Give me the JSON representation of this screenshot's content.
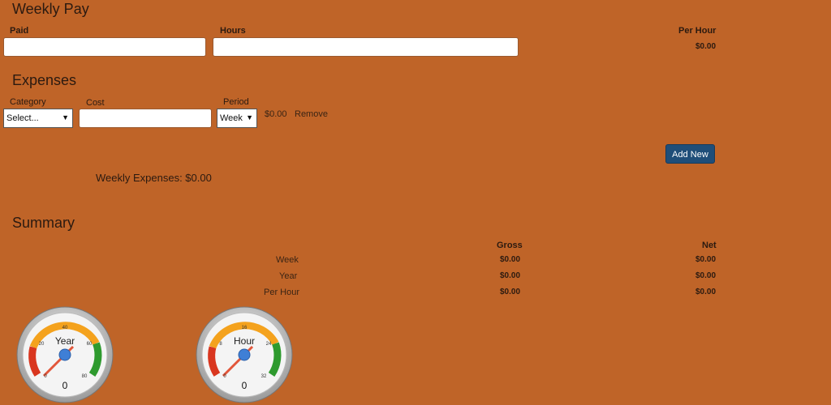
{
  "weekly_pay": {
    "title": "Weekly Pay",
    "paid_label": "Paid",
    "hours_label": "Hours",
    "per_hour_label": "Per Hour",
    "per_hour_value": "$0.00",
    "paid_value": "",
    "hours_value": ""
  },
  "expenses": {
    "title": "Expenses",
    "category_label": "Category",
    "category_value": "Select...",
    "cost_label": "Cost",
    "cost_value": "",
    "period_label": "Period",
    "period_value": "Week",
    "amount": "$0.00",
    "remove_label": "Remove",
    "add_new_label": "Add New",
    "weekly_expenses": "Weekly Expenses: $0.00"
  },
  "summary": {
    "title": "Summary",
    "gross_header": "Gross",
    "net_header": "Net",
    "rows": [
      {
        "label": "Week",
        "gross": "$0.00",
        "net": "$0.00"
      },
      {
        "label": "Year",
        "gross": "$0.00",
        "net": "$0.00"
      },
      {
        "label": "Per Hour",
        "gross": "$0.00",
        "net": "$0.00"
      }
    ]
  },
  "gauges": [
    {
      "title": "Year",
      "value": "0",
      "ticks": [
        "0",
        "20",
        "40",
        "60",
        "80"
      ]
    },
    {
      "title": "Hour",
      "value": "0",
      "ticks": [
        "0",
        "8",
        "16",
        "24",
        "32"
      ]
    }
  ],
  "colors": {
    "background": "#bf6428",
    "button": "#1f4e79",
    "gauge_red": "#d9361f",
    "gauge_orange": "#f4a21d",
    "gauge_green": "#2e9a2e",
    "needle": "#e2563a",
    "hub": "#3f7fd6"
  }
}
